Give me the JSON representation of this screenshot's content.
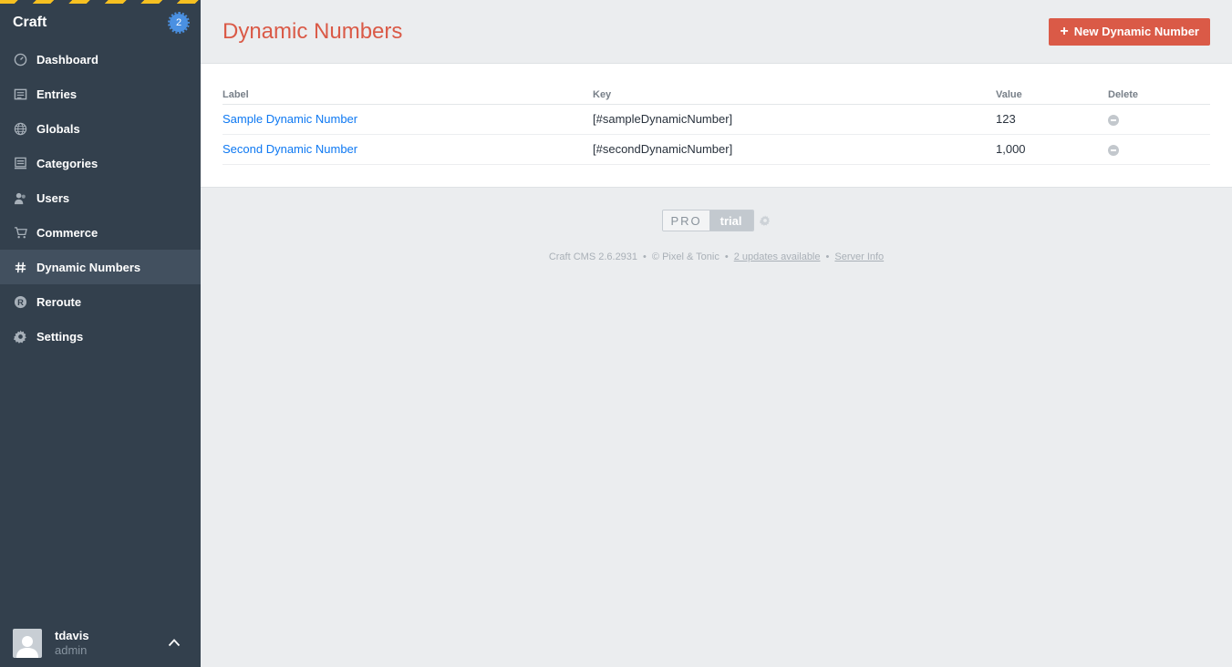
{
  "app": {
    "name": "Craft",
    "badge_count": "2"
  },
  "sidebar": {
    "items": [
      {
        "label": "Dashboard",
        "icon": "dashboard-icon"
      },
      {
        "label": "Entries",
        "icon": "entries-icon"
      },
      {
        "label": "Globals",
        "icon": "globe-icon"
      },
      {
        "label": "Categories",
        "icon": "categories-icon"
      },
      {
        "label": "Users",
        "icon": "users-icon"
      },
      {
        "label": "Commerce",
        "icon": "cart-icon"
      },
      {
        "label": "Dynamic Numbers",
        "icon": "hash-icon",
        "active": true
      },
      {
        "label": "Reroute",
        "icon": "reroute-icon"
      },
      {
        "label": "Settings",
        "icon": "gear-icon"
      }
    ]
  },
  "user": {
    "name": "tdavis",
    "role": "admin"
  },
  "header": {
    "title": "Dynamic Numbers",
    "new_button": "New Dynamic Number"
  },
  "table": {
    "columns": [
      "Label",
      "Key",
      "Value",
      "Delete"
    ],
    "rows": [
      {
        "label": "Sample Dynamic Number",
        "key": "[#sampleDynamicNumber]",
        "value": "123"
      },
      {
        "label": "Second Dynamic Number",
        "key": "[#secondDynamicNumber]",
        "value": "1,000"
      }
    ]
  },
  "footer": {
    "edition_pro": "PRO",
    "edition_trial": "trial",
    "version": "Craft CMS 2.6.2931",
    "copyright": "© Pixel & Tonic",
    "updates": "2 updates available",
    "server_info": "Server Info"
  },
  "colors": {
    "accent": "#da5a47",
    "link": "#0d78f2",
    "sidebar": "#33404d"
  }
}
